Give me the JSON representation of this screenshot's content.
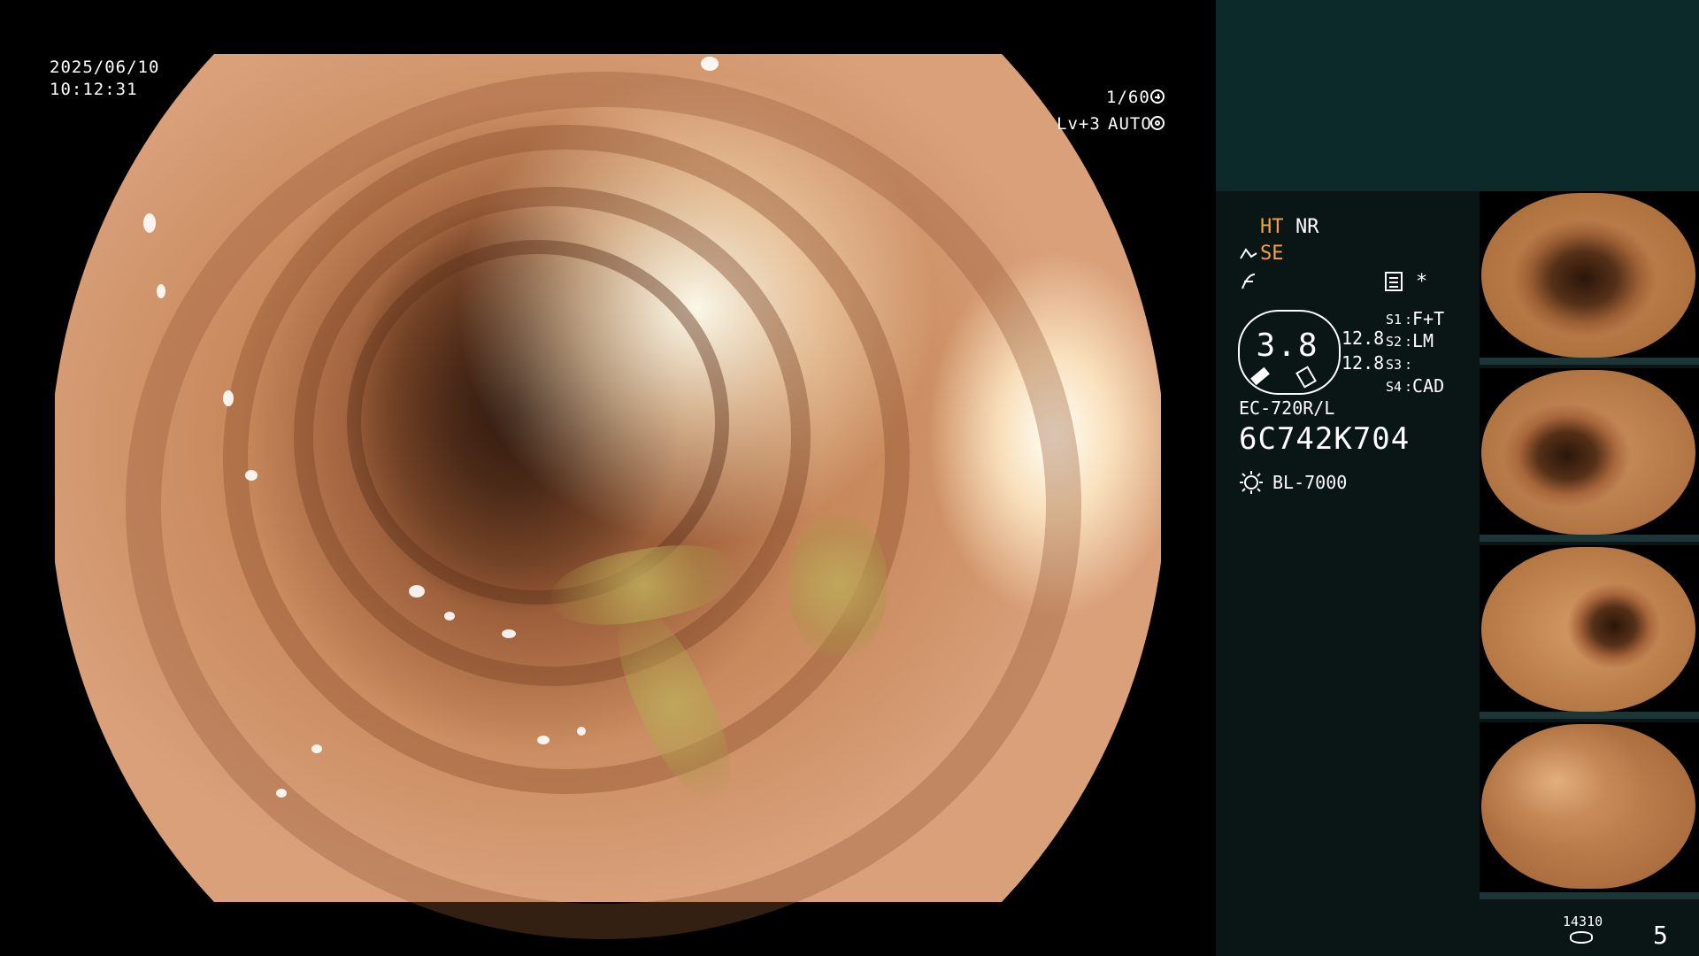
{
  "scope": {
    "date": "2025/06/10",
    "time": "10:12:31",
    "shutter": "1/60",
    "level": "Lv+3",
    "mode": "AUTO",
    "shutter_icon": "aperture-icon",
    "mode_icon": "target-icon"
  },
  "panel": {
    "ht": "HT",
    "nr": "NR",
    "se": "SE",
    "scope_icon": "endoscope-icon",
    "f_icon": "f-icon",
    "menu_icon": "settings-icon",
    "star": "*",
    "gauge_value": "3.8",
    "gauge_left": "12.8",
    "gauge_right": "12.8",
    "s1": "S1",
    "s1_value": "F+T",
    "s2": "S2",
    "s2_value": "LM",
    "s3": "S3",
    "s3_value": "",
    "s4": "S4",
    "s4_value": "CAD",
    "scope_model": "EC-720R/L",
    "serial": "6C742K704",
    "light_source": "BL-7000",
    "storage_count": "14310",
    "frame_number": "5"
  },
  "colors": {
    "accent": "#f5a43c",
    "panel_top": "#0d2a2b",
    "panel_bottom": "#0a1515"
  }
}
